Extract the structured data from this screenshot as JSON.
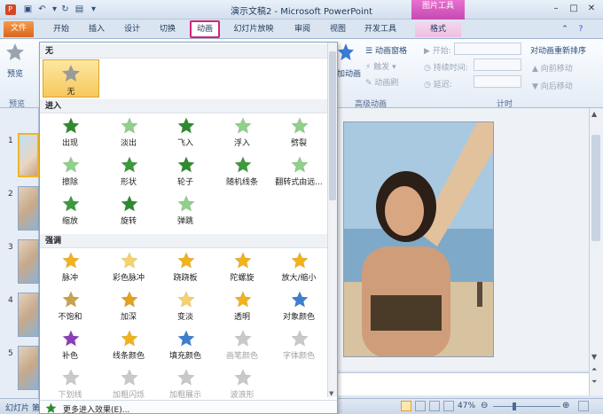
{
  "window": {
    "title": "演示文稿2 - Microsoft PowerPoint",
    "context_tab_group": "图片工具"
  },
  "tabs": [
    {
      "label": "文件"
    },
    {
      "label": "开始"
    },
    {
      "label": "插入"
    },
    {
      "label": "设计"
    },
    {
      "label": "切换"
    },
    {
      "label": "动画"
    },
    {
      "label": "幻灯片放映"
    },
    {
      "label": "审阅"
    },
    {
      "label": "视图"
    },
    {
      "label": "开发工具"
    },
    {
      "label": "格式"
    }
  ],
  "ribbon": {
    "preview_label": "预览",
    "preview_group": "预览",
    "add_anim_label": "加动画",
    "anim_pane": "动画窗格",
    "trigger": "触发",
    "anim_painter": "动画刷",
    "adv_group": "高级动画",
    "start_label": "开始:",
    "duration_label": "持续时间:",
    "delay_label": "延迟:",
    "reorder_title": "对动画重新排序",
    "move_earlier": "向前移动",
    "move_later": "向后移动",
    "timing_group": "计时"
  },
  "gallery": {
    "sections": {
      "none": "无",
      "entrance": "进入",
      "emphasis": "强调"
    },
    "none_item": "无",
    "entrance_items": [
      {
        "label": "出现",
        "color": "#2f8a2f"
      },
      {
        "label": "淡出",
        "color": "#8fd08a"
      },
      {
        "label": "飞入",
        "color": "#2f8a2f"
      },
      {
        "label": "浮入",
        "color": "#8fd08a"
      },
      {
        "label": "劈裂",
        "color": "#8fd08a"
      },
      {
        "label": "擦除",
        "color": "#8fd08a"
      },
      {
        "label": "形状",
        "color": "#3b9a3b"
      },
      {
        "label": "轮子",
        "color": "#2f8a2f"
      },
      {
        "label": "随机线条",
        "color": "#3b9a3b"
      },
      {
        "label": "翻转式由远...",
        "color": "#8fd08a"
      },
      {
        "label": "缩放",
        "color": "#3b9a3b"
      },
      {
        "label": "旋转",
        "color": "#2f8a2f"
      },
      {
        "label": "弹跳",
        "color": "#8fd08a"
      }
    ],
    "emphasis_items": [
      {
        "label": "脉冲",
        "color": "#f2b21b",
        "disabled": false
      },
      {
        "label": "彩色脉冲",
        "color": "#f7d26a",
        "disabled": false
      },
      {
        "label": "跷跷板",
        "color": "#f2b21b",
        "disabled": false
      },
      {
        "label": "陀螺旋",
        "color": "#f2b21b",
        "disabled": false
      },
      {
        "label": "放大/缩小",
        "color": "#f2b21b",
        "disabled": false
      },
      {
        "label": "不饱和",
        "color": "#c9a24a",
        "disabled": false
      },
      {
        "label": "加深",
        "color": "#e2a21a",
        "disabled": false
      },
      {
        "label": "变淡",
        "color": "#f7d26a",
        "disabled": false
      },
      {
        "label": "透明",
        "color": "#f2b21b",
        "disabled": false
      },
      {
        "label": "对象颜色",
        "color": "#3b7fd0",
        "disabled": false
      },
      {
        "label": "补色",
        "color": "#8a3fb8",
        "disabled": false
      },
      {
        "label": "线条颜色",
        "color": "#f2b21b",
        "disabled": false
      },
      {
        "label": "填充颜色",
        "color": "#3b7fd0",
        "disabled": false
      },
      {
        "label": "画笔颜色",
        "color": "#c9c9c9",
        "disabled": true
      },
      {
        "label": "字体颜色",
        "color": "#c9c9c9",
        "disabled": true
      },
      {
        "label": "下划线",
        "color": "#c9c9c9",
        "disabled": true
      },
      {
        "label": "加粗闪烁",
        "color": "#c9c9c9",
        "disabled": true
      },
      {
        "label": "加粗展示",
        "color": "#c9c9c9",
        "disabled": true
      },
      {
        "label": "波浪形",
        "color": "#c9c9c9",
        "disabled": true
      }
    ],
    "more_entrance": "更多进入效果(E)..."
  },
  "slides": {
    "numbers": [
      "1",
      "2",
      "3",
      "4",
      "5"
    ]
  },
  "status": {
    "left_text": "幻灯片 第",
    "zoom": "47%"
  }
}
